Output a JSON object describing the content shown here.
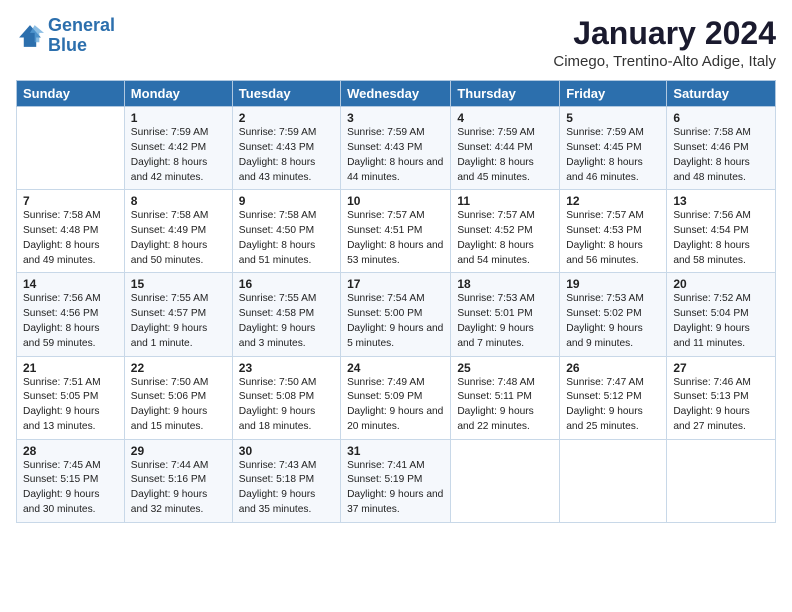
{
  "logo": {
    "line1": "General",
    "line2": "Blue"
  },
  "title": "January 2024",
  "location": "Cimego, Trentino-Alto Adige, Italy",
  "days_of_week": [
    "Sunday",
    "Monday",
    "Tuesday",
    "Wednesday",
    "Thursday",
    "Friday",
    "Saturday"
  ],
  "weeks": [
    [
      {
        "num": "",
        "sunrise": "",
        "sunset": "",
        "daylight": ""
      },
      {
        "num": "1",
        "sunrise": "Sunrise: 7:59 AM",
        "sunset": "Sunset: 4:42 PM",
        "daylight": "Daylight: 8 hours and 42 minutes."
      },
      {
        "num": "2",
        "sunrise": "Sunrise: 7:59 AM",
        "sunset": "Sunset: 4:43 PM",
        "daylight": "Daylight: 8 hours and 43 minutes."
      },
      {
        "num": "3",
        "sunrise": "Sunrise: 7:59 AM",
        "sunset": "Sunset: 4:43 PM",
        "daylight": "Daylight: 8 hours and 44 minutes."
      },
      {
        "num": "4",
        "sunrise": "Sunrise: 7:59 AM",
        "sunset": "Sunset: 4:44 PM",
        "daylight": "Daylight: 8 hours and 45 minutes."
      },
      {
        "num": "5",
        "sunrise": "Sunrise: 7:59 AM",
        "sunset": "Sunset: 4:45 PM",
        "daylight": "Daylight: 8 hours and 46 minutes."
      },
      {
        "num": "6",
        "sunrise": "Sunrise: 7:58 AM",
        "sunset": "Sunset: 4:46 PM",
        "daylight": "Daylight: 8 hours and 48 minutes."
      }
    ],
    [
      {
        "num": "7",
        "sunrise": "Sunrise: 7:58 AM",
        "sunset": "Sunset: 4:48 PM",
        "daylight": "Daylight: 8 hours and 49 minutes."
      },
      {
        "num": "8",
        "sunrise": "Sunrise: 7:58 AM",
        "sunset": "Sunset: 4:49 PM",
        "daylight": "Daylight: 8 hours and 50 minutes."
      },
      {
        "num": "9",
        "sunrise": "Sunrise: 7:58 AM",
        "sunset": "Sunset: 4:50 PM",
        "daylight": "Daylight: 8 hours and 51 minutes."
      },
      {
        "num": "10",
        "sunrise": "Sunrise: 7:57 AM",
        "sunset": "Sunset: 4:51 PM",
        "daylight": "Daylight: 8 hours and 53 minutes."
      },
      {
        "num": "11",
        "sunrise": "Sunrise: 7:57 AM",
        "sunset": "Sunset: 4:52 PM",
        "daylight": "Daylight: 8 hours and 54 minutes."
      },
      {
        "num": "12",
        "sunrise": "Sunrise: 7:57 AM",
        "sunset": "Sunset: 4:53 PM",
        "daylight": "Daylight: 8 hours and 56 minutes."
      },
      {
        "num": "13",
        "sunrise": "Sunrise: 7:56 AM",
        "sunset": "Sunset: 4:54 PM",
        "daylight": "Daylight: 8 hours and 58 minutes."
      }
    ],
    [
      {
        "num": "14",
        "sunrise": "Sunrise: 7:56 AM",
        "sunset": "Sunset: 4:56 PM",
        "daylight": "Daylight: 8 hours and 59 minutes."
      },
      {
        "num": "15",
        "sunrise": "Sunrise: 7:55 AM",
        "sunset": "Sunset: 4:57 PM",
        "daylight": "Daylight: 9 hours and 1 minute."
      },
      {
        "num": "16",
        "sunrise": "Sunrise: 7:55 AM",
        "sunset": "Sunset: 4:58 PM",
        "daylight": "Daylight: 9 hours and 3 minutes."
      },
      {
        "num": "17",
        "sunrise": "Sunrise: 7:54 AM",
        "sunset": "Sunset: 5:00 PM",
        "daylight": "Daylight: 9 hours and 5 minutes."
      },
      {
        "num": "18",
        "sunrise": "Sunrise: 7:53 AM",
        "sunset": "Sunset: 5:01 PM",
        "daylight": "Daylight: 9 hours and 7 minutes."
      },
      {
        "num": "19",
        "sunrise": "Sunrise: 7:53 AM",
        "sunset": "Sunset: 5:02 PM",
        "daylight": "Daylight: 9 hours and 9 minutes."
      },
      {
        "num": "20",
        "sunrise": "Sunrise: 7:52 AM",
        "sunset": "Sunset: 5:04 PM",
        "daylight": "Daylight: 9 hours and 11 minutes."
      }
    ],
    [
      {
        "num": "21",
        "sunrise": "Sunrise: 7:51 AM",
        "sunset": "Sunset: 5:05 PM",
        "daylight": "Daylight: 9 hours and 13 minutes."
      },
      {
        "num": "22",
        "sunrise": "Sunrise: 7:50 AM",
        "sunset": "Sunset: 5:06 PM",
        "daylight": "Daylight: 9 hours and 15 minutes."
      },
      {
        "num": "23",
        "sunrise": "Sunrise: 7:50 AM",
        "sunset": "Sunset: 5:08 PM",
        "daylight": "Daylight: 9 hours and 18 minutes."
      },
      {
        "num": "24",
        "sunrise": "Sunrise: 7:49 AM",
        "sunset": "Sunset: 5:09 PM",
        "daylight": "Daylight: 9 hours and 20 minutes."
      },
      {
        "num": "25",
        "sunrise": "Sunrise: 7:48 AM",
        "sunset": "Sunset: 5:11 PM",
        "daylight": "Daylight: 9 hours and 22 minutes."
      },
      {
        "num": "26",
        "sunrise": "Sunrise: 7:47 AM",
        "sunset": "Sunset: 5:12 PM",
        "daylight": "Daylight: 9 hours and 25 minutes."
      },
      {
        "num": "27",
        "sunrise": "Sunrise: 7:46 AM",
        "sunset": "Sunset: 5:13 PM",
        "daylight": "Daylight: 9 hours and 27 minutes."
      }
    ],
    [
      {
        "num": "28",
        "sunrise": "Sunrise: 7:45 AM",
        "sunset": "Sunset: 5:15 PM",
        "daylight": "Daylight: 9 hours and 30 minutes."
      },
      {
        "num": "29",
        "sunrise": "Sunrise: 7:44 AM",
        "sunset": "Sunset: 5:16 PM",
        "daylight": "Daylight: 9 hours and 32 minutes."
      },
      {
        "num": "30",
        "sunrise": "Sunrise: 7:43 AM",
        "sunset": "Sunset: 5:18 PM",
        "daylight": "Daylight: 9 hours and 35 minutes."
      },
      {
        "num": "31",
        "sunrise": "Sunrise: 7:41 AM",
        "sunset": "Sunset: 5:19 PM",
        "daylight": "Daylight: 9 hours and 37 minutes."
      },
      {
        "num": "",
        "sunrise": "",
        "sunset": "",
        "daylight": ""
      },
      {
        "num": "",
        "sunrise": "",
        "sunset": "",
        "daylight": ""
      },
      {
        "num": "",
        "sunrise": "",
        "sunset": "",
        "daylight": ""
      }
    ]
  ]
}
